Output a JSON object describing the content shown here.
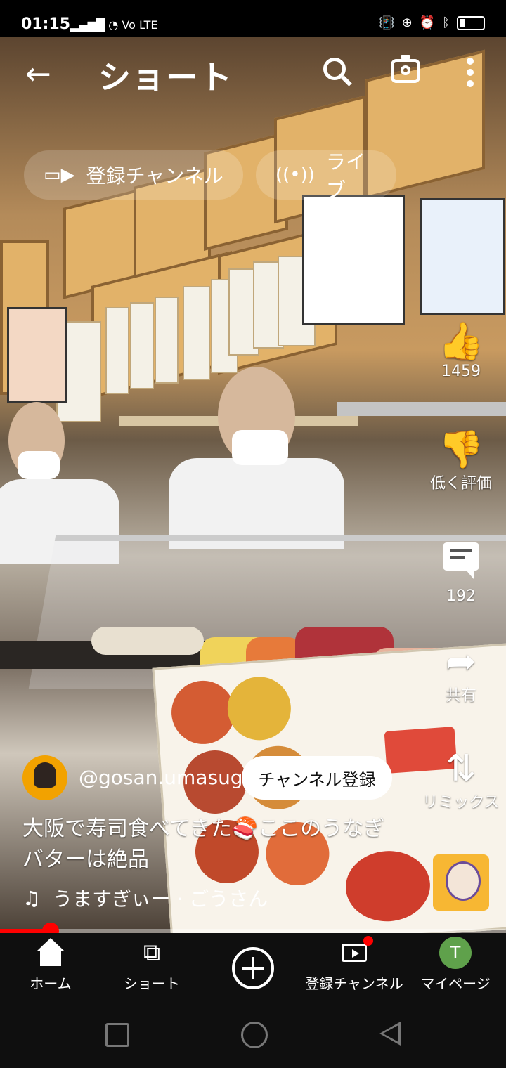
{
  "status_bar": {
    "time": "01:15",
    "network": "Vo LTE"
  },
  "header": {
    "title": "ショート"
  },
  "chips": [
    {
      "label": "登録チャンネル",
      "icon": "subscriptions-icon"
    },
    {
      "label": "ライブ",
      "icon": "live-icon"
    }
  ],
  "actions": {
    "like_count": "1459",
    "dislike_label": "低く評価",
    "comment_count": "192",
    "share_label": "共有",
    "remix_label": "リミックス"
  },
  "video": {
    "channel_handle": "@gosan.umasugi",
    "subscribe_label": "チャンネル登録",
    "caption": "大阪で寿司食べてきた🍣ここのうなぎバターは絶品",
    "music": "うますぎぃー · ごうさん",
    "progress": 0.1
  },
  "bottom_nav": [
    {
      "label": "ホーム",
      "icon": "home-icon"
    },
    {
      "label": "ショート",
      "icon": "shorts-icon"
    },
    {
      "label": "",
      "icon": "create-icon"
    },
    {
      "label": "登録チャンネル",
      "icon": "subscriptions-icon"
    },
    {
      "label": "マイページ",
      "icon": "avatar-icon",
      "avatar_letter": "T"
    }
  ],
  "colors": {
    "accent": "#ff0000",
    "avatar_bg": "#5fa14b",
    "nav_bg": "#0f0f0f"
  }
}
